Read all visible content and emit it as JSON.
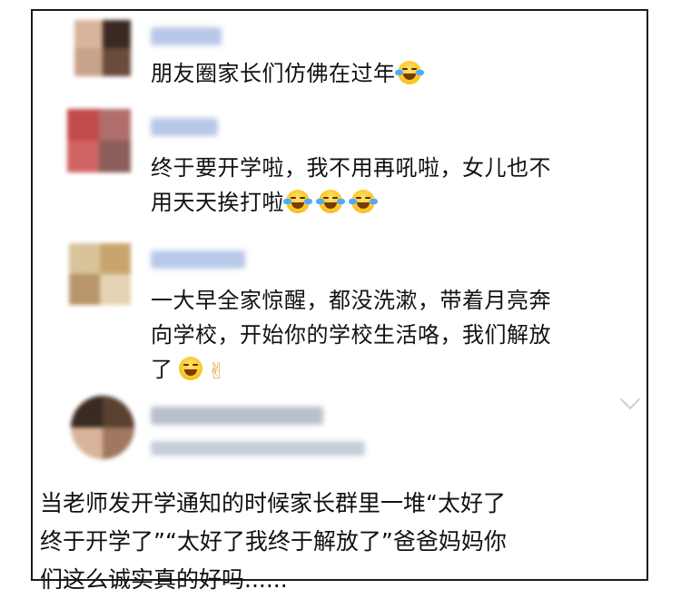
{
  "comments": [
    {
      "text": "朋友圈家长们仿佛在过年",
      "emoji": "laughing-tears-icon"
    },
    {
      "text_line1": "终于要开学啦，我不用再吼啦，女儿也不",
      "text_line2": "用天天挨打啦",
      "emoji": "laughing-tears-icon"
    },
    {
      "text_line1": "一大早全家惊醒，都没洗漱，带着月亮奔",
      "text_line2": "向学校，开始你的学校生活咯，我们解放",
      "text_line3": "了",
      "emoji1": "grinning-icon",
      "emoji2": "victory-hand-icon"
    }
  ],
  "caption": {
    "line1": "当老师发开学通知的时候家长群里一堆“太好了",
    "line2": "终于开学了”“太好了我终于解放了”爸爸妈妈你",
    "line3": "们这么诚实真的好吗......"
  }
}
